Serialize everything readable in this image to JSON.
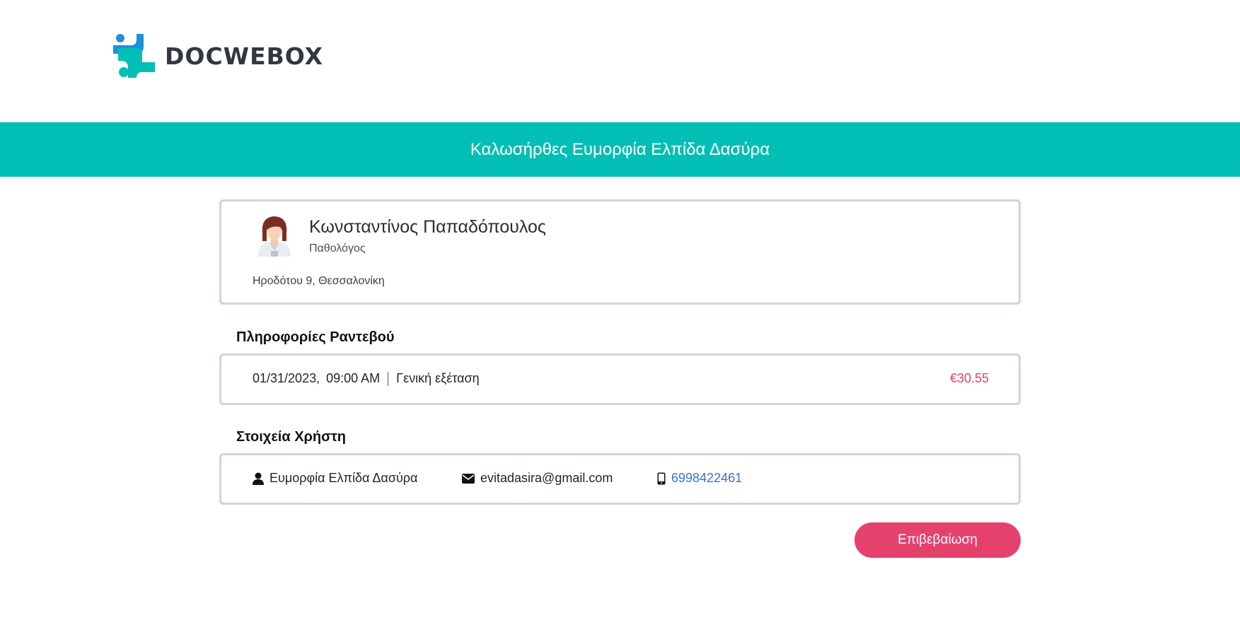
{
  "brand": {
    "name": "DOCWEBOX",
    "logo_icon": "docwebox-cross-logo"
  },
  "banner": {
    "text": "Καλωσήρθες Ευμορφία Ελπίδα Δασύρα",
    "color": "#02bfb5"
  },
  "doctor": {
    "avatar_icon": "doctor-avatar-icon",
    "name": "Κωνσταντίνος Παπαδόπουλος",
    "specialty": "Παθολόγος",
    "address": "Ηροδότου 9, Θεσσαλονίκη"
  },
  "appointment": {
    "section_title": "Πληροφορίες Ραντεβού",
    "date": "01/31/2023,",
    "time": "09:00 AM",
    "service": "Γενική εξέταση",
    "price": "€30.55"
  },
  "user": {
    "section_title": "Στοιχεία Χρήστη",
    "name": "Ευμορφία Ελπίδα Δασύρα",
    "email": "evitadasira@gmail.com",
    "phone": "6998422461",
    "icons": {
      "name": "user-icon",
      "email": "envelope-icon",
      "phone": "mobile-phone-icon"
    }
  },
  "actions": {
    "confirm_label": "Επιβεβαίωση"
  },
  "colors": {
    "accent": "#02bfb5",
    "primary_button": "#e5416f",
    "price": "#e0445e",
    "link": "#3b6fd6"
  }
}
